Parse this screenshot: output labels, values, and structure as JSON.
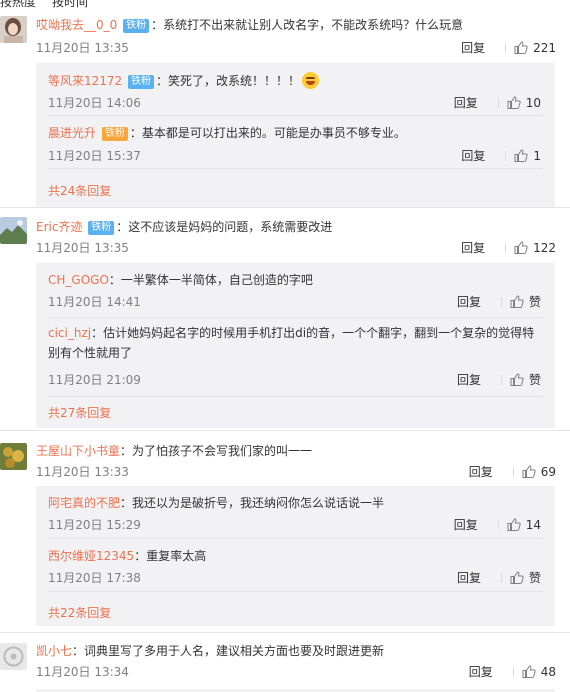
{
  "topbar": {
    "tab1": "按热度",
    "tab2": "按时间"
  },
  "icons": {
    "like": "thumbs-up-icon",
    "badge": "fan-badge"
  },
  "colors": {
    "username": "#eb7350",
    "badge": "#5ab0f0",
    "subbg": "#f2f2f5"
  },
  "comments": [
    {
      "user": "哎呦我去__0_0",
      "badge": "铁粉",
      "text": "系统打不出来就让别人改名字，不能改系统吗？什么玩意",
      "time": "11月20日 13:35",
      "reply": "回复",
      "likes": "221",
      "subs": [
        {
          "user": "等风来12172",
          "badge": "铁粉",
          "text": "笑死了，改系统！！！！",
          "time": "11月20日 14:06",
          "reply": "回复",
          "likes": "10"
        },
        {
          "user": "晨进光升",
          "badge": "铁粉",
          "text": "基本都是可以打出来的。可能是办事员不够专业。",
          "time": "11月20日 15:37",
          "reply": "回复",
          "likes": "1"
        }
      ],
      "more": "共24条回复"
    },
    {
      "user": "Eric齐迹",
      "badge": "铁粉",
      "text": "这不应该是妈妈的问题，系统需要改进",
      "time": "11月20日 13:35",
      "reply": "回复",
      "likes": "122",
      "subs": [
        {
          "user": "CH_GOGO",
          "text": "一半繁体一半简体，自己创造的字吧",
          "time": "11月20日 14:41",
          "reply": "回复",
          "likes": "赞"
        },
        {
          "user": "cici_hzj",
          "text": "估计她妈妈起名字的时候用手机打出di的音，一个个翻字，翻到一个复杂的觉得特别有个性就用了",
          "time": "11月20日 21:09",
          "reply": "回复",
          "likes": "赞"
        }
      ],
      "more": "共27条回复"
    },
    {
      "user": "王屋山下小书童",
      "text": "为了怕孩子不会写我们家的叫一一",
      "time": "11月20日 13:33",
      "reply": "回复",
      "likes": "69",
      "subs": [
        {
          "user": "阿宅真的不肥",
          "text": "我还以为是破折号，我还纳闷你怎么说话说一半",
          "time": "11月20日 15:29",
          "reply": "回复",
          "likes": "14"
        },
        {
          "user": "西尔维娅12345",
          "text": "重复率太高",
          "time": "11月20日 17:38",
          "reply": "回复",
          "likes": "赞"
        }
      ],
      "more": "共22条回复"
    },
    {
      "user": "凯小七",
      "text": "词典里写了多用于人名，建议相关方面也要及时跟进更新",
      "time": "11月20日 13:34",
      "reply": "回复",
      "likes": "48"
    }
  ]
}
